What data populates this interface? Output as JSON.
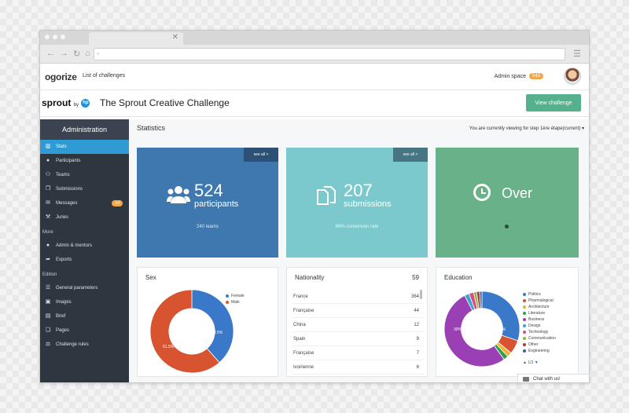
{
  "app": {
    "logo": "ogorize",
    "nav_link": "List of challenges",
    "admin_space": "Admin space",
    "admin_badge": "543"
  },
  "challenge": {
    "brand": "sprout",
    "brand_by": "by",
    "brand_hp": "hp",
    "title": "The Sprout Creative Challenge",
    "view_button": "View challenge"
  },
  "sidebar": {
    "header": "Administration",
    "items": [
      {
        "label": "Stats",
        "icon": "bar-chart-icon",
        "active": true
      },
      {
        "label": "Participants",
        "icon": "user-icon"
      },
      {
        "label": "Teams",
        "icon": "users-icon"
      },
      {
        "label": "Submissions",
        "icon": "files-icon"
      },
      {
        "label": "Messages",
        "icon": "envelope-icon",
        "badge": "14"
      },
      {
        "label": "Juries",
        "icon": "gavel-icon"
      }
    ],
    "section_more": "More",
    "more_items": [
      {
        "label": "Admin & mentors",
        "icon": "user-icon"
      },
      {
        "label": "Exports",
        "icon": "share-icon"
      }
    ],
    "section_edition": "Edition",
    "edition_items": [
      {
        "label": "General parameters",
        "icon": "list-icon"
      },
      {
        "label": "Images",
        "icon": "image-icon"
      },
      {
        "label": "Brief",
        "icon": "file-icon"
      },
      {
        "label": "Pages",
        "icon": "copy-icon"
      },
      {
        "label": "Challenge rules",
        "icon": "rules-icon"
      }
    ]
  },
  "content": {
    "title": "Statistics",
    "step_note_prefix": "You are currently viewing for step",
    "step_name": "1ère étape",
    "step_state": "(current)",
    "see_all": "see all >"
  },
  "tiles": {
    "participants": {
      "number": "524",
      "word": "participants",
      "sub": "240 teams"
    },
    "submissions": {
      "number": "207",
      "word": "submissions",
      "sub": "86% conversion rate"
    },
    "status": {
      "word": "Over"
    }
  },
  "sex": {
    "title": "Sex",
    "legend": [
      {
        "label": "Female",
        "color": "#3a78c9"
      },
      {
        "label": "Male",
        "color": "#d8532f"
      }
    ],
    "values_label": [
      "38.5%",
      "61.5%"
    ]
  },
  "nationality": {
    "title": "Nationality",
    "count": "59",
    "rows": [
      {
        "name": "France",
        "value": "364"
      },
      {
        "name": "Française",
        "value": "44"
      },
      {
        "name": "China",
        "value": "12"
      },
      {
        "name": "Spain",
        "value": "9"
      },
      {
        "name": "Française",
        "value": "7"
      },
      {
        "name": "Ivoirienne",
        "value": "6"
      }
    ]
  },
  "education": {
    "title": "Education",
    "legend": [
      {
        "label": "Politics",
        "color": "#3a78c9"
      },
      {
        "label": "Pharmalogical",
        "color": "#d8532f"
      },
      {
        "label": "Architecture",
        "color": "#f2b134"
      },
      {
        "label": "Literature",
        "color": "#2fa14a"
      },
      {
        "label": "Business",
        "color": "#9b3fb5"
      },
      {
        "label": "Design",
        "color": "#3aa5c9"
      },
      {
        "label": "Technology",
        "color": "#d84a8c"
      },
      {
        "label": "Communication",
        "color": "#8fb83a"
      },
      {
        "label": "Other",
        "color": "#a33f3f"
      },
      {
        "label": "Engineering",
        "color": "#3a5fa8"
      }
    ],
    "values_label": [
      "30%",
      "52.4%"
    ],
    "pager": "1/3"
  },
  "chat": {
    "label": "Chat with us!"
  },
  "chart_data": [
    {
      "type": "pie",
      "title": "Sex",
      "categories": [
        "Female",
        "Male"
      ],
      "values": [
        38.5,
        61.5
      ]
    },
    {
      "type": "pie",
      "title": "Education",
      "categories": [
        "Politics",
        "Pharmalogical",
        "Architecture",
        "Literature",
        "Business",
        "Design",
        "Technology",
        "Communication",
        "Other",
        "Engineering"
      ],
      "values": [
        30,
        6,
        2,
        2,
        52.4,
        2,
        2,
        1.3,
        1.3,
        1
      ]
    }
  ]
}
